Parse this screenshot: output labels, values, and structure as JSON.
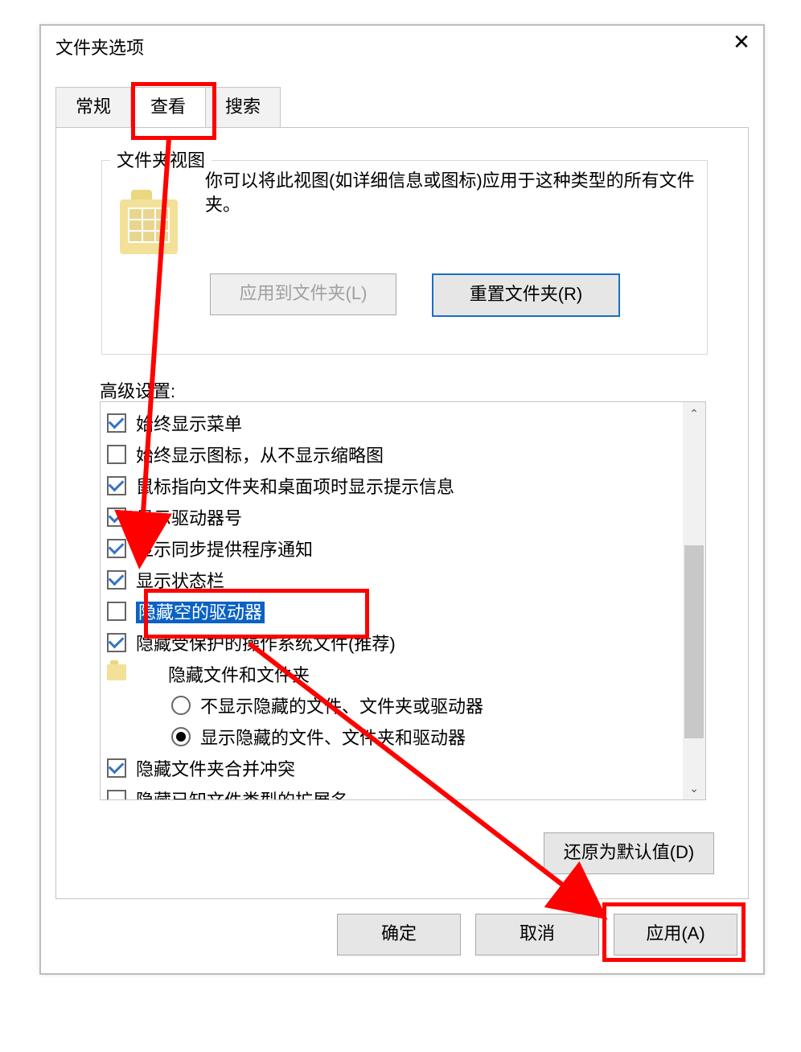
{
  "title": "文件夹选项",
  "tabs": {
    "general": "常规",
    "view": "查看",
    "search": "搜索"
  },
  "group": {
    "label": "文件夹视图",
    "description": "你可以将此视图(如详细信息或图标)应用于这种类型的所有文件夹。",
    "apply_to_folders": "应用到文件夹(L)",
    "reset_folders": "重置文件夹(R)"
  },
  "advanced_label": "高级设置:",
  "items": [
    {
      "type": "checkbox",
      "checked": true,
      "label": "始终显示菜单"
    },
    {
      "type": "checkbox",
      "checked": false,
      "label": "始终显示图标，从不显示缩略图"
    },
    {
      "type": "checkbox",
      "checked": true,
      "label": "鼠标指向文件夹和桌面项时显示提示信息"
    },
    {
      "type": "checkbox",
      "checked": true,
      "label": "显示驱动器号"
    },
    {
      "type": "checkbox",
      "checked": true,
      "label": "显示同步提供程序通知"
    },
    {
      "type": "checkbox",
      "checked": true,
      "label": "显示状态栏"
    },
    {
      "type": "checkbox",
      "checked": false,
      "highlighted": true,
      "label": "隐藏空的驱动器"
    },
    {
      "type": "checkbox",
      "checked": true,
      "label": "隐藏受保护的操作系统文件(推荐)"
    },
    {
      "type": "folder",
      "indent": 1,
      "label": "隐藏文件和文件夹"
    },
    {
      "type": "radio",
      "indent": 2,
      "checked": false,
      "label": "不显示隐藏的文件、文件夹或驱动器"
    },
    {
      "type": "radio",
      "indent": 2,
      "checked": true,
      "label": "显示隐藏的文件、文件夹和驱动器"
    },
    {
      "type": "checkbox",
      "checked": true,
      "label": "隐藏文件夹合并冲突"
    },
    {
      "type": "checkbox",
      "checked": false,
      "label": "隐藏已知文件类型的扩展名"
    }
  ],
  "buttons": {
    "restore_defaults": "还原为默认值(D)",
    "ok": "确定",
    "cancel": "取消",
    "apply": "应用(A)"
  }
}
